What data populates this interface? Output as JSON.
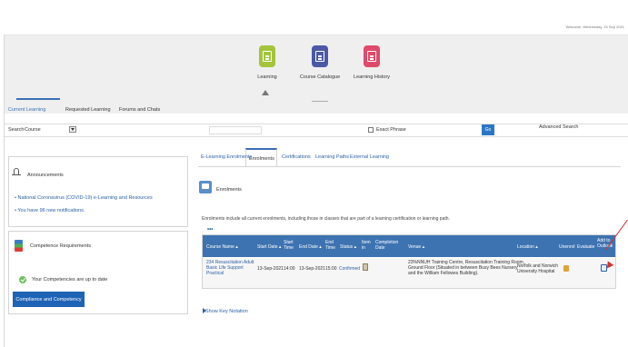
{
  "header": {
    "top_right_text": "Welcome, Wednesday, 15 Sep 2021",
    "nav": [
      {
        "label": "Learning",
        "color": "#a3c43b"
      },
      {
        "label": "Course Catalogue",
        "color": "#4a5aa6"
      },
      {
        "label": "Learning History",
        "color": "#e04a6a"
      }
    ],
    "tabs": [
      "Current Learning",
      "Requested Learning",
      "Forums and Chats"
    ]
  },
  "search": {
    "label": "Search",
    "scope": "Course",
    "exact_phrase": "Exact Phrase",
    "go": "Go",
    "advanced": "Advanced Search"
  },
  "announcements": {
    "title": "Announcements",
    "links": [
      "National Coronavirus (COVID-19) e-Learning and Resources",
      "You have 96 new notifications."
    ]
  },
  "competence": {
    "title": "Competence Requirements",
    "status": "Your Competencies are up to date",
    "button": "Compliance and Competency"
  },
  "main": {
    "subtabs": [
      "E-Learning Enrolments",
      "Enrolments",
      "Certifications",
      "Learning Paths",
      "External Learning"
    ],
    "section_title": "Enrolments",
    "description": "Enrolments include all current enrolments, including those in classes that are part of a learning certification or learning path.",
    "more": "•••",
    "table": {
      "headers": [
        "Course Name",
        "Start Date",
        "Start Time",
        "End Date",
        "End Time",
        "Status",
        "Item in",
        "Completion Date",
        "Venue",
        "Location",
        "Unenrol",
        "Evaluate",
        "Add to Outlook"
      ],
      "row": {
        "course": [
          "234 Resuscitation Adult",
          "Basic Life Support",
          "Practical"
        ],
        "start_date": "13-Sep-2021",
        "start_time": "14:00",
        "end_date": "13-Sep-2021",
        "end_time": "15:00",
        "status": "Confirmed",
        "venue": [
          "23%NNUH Training Centre, Resuscitation Training Room,",
          "Ground Floor (Situated in between Busy Bees Nursery",
          "and the William Fellowes Building)."
        ],
        "location": [
          "Norfolk and Norwich",
          "University Hospital"
        ]
      }
    },
    "key_notation": "Show Key Notation"
  }
}
